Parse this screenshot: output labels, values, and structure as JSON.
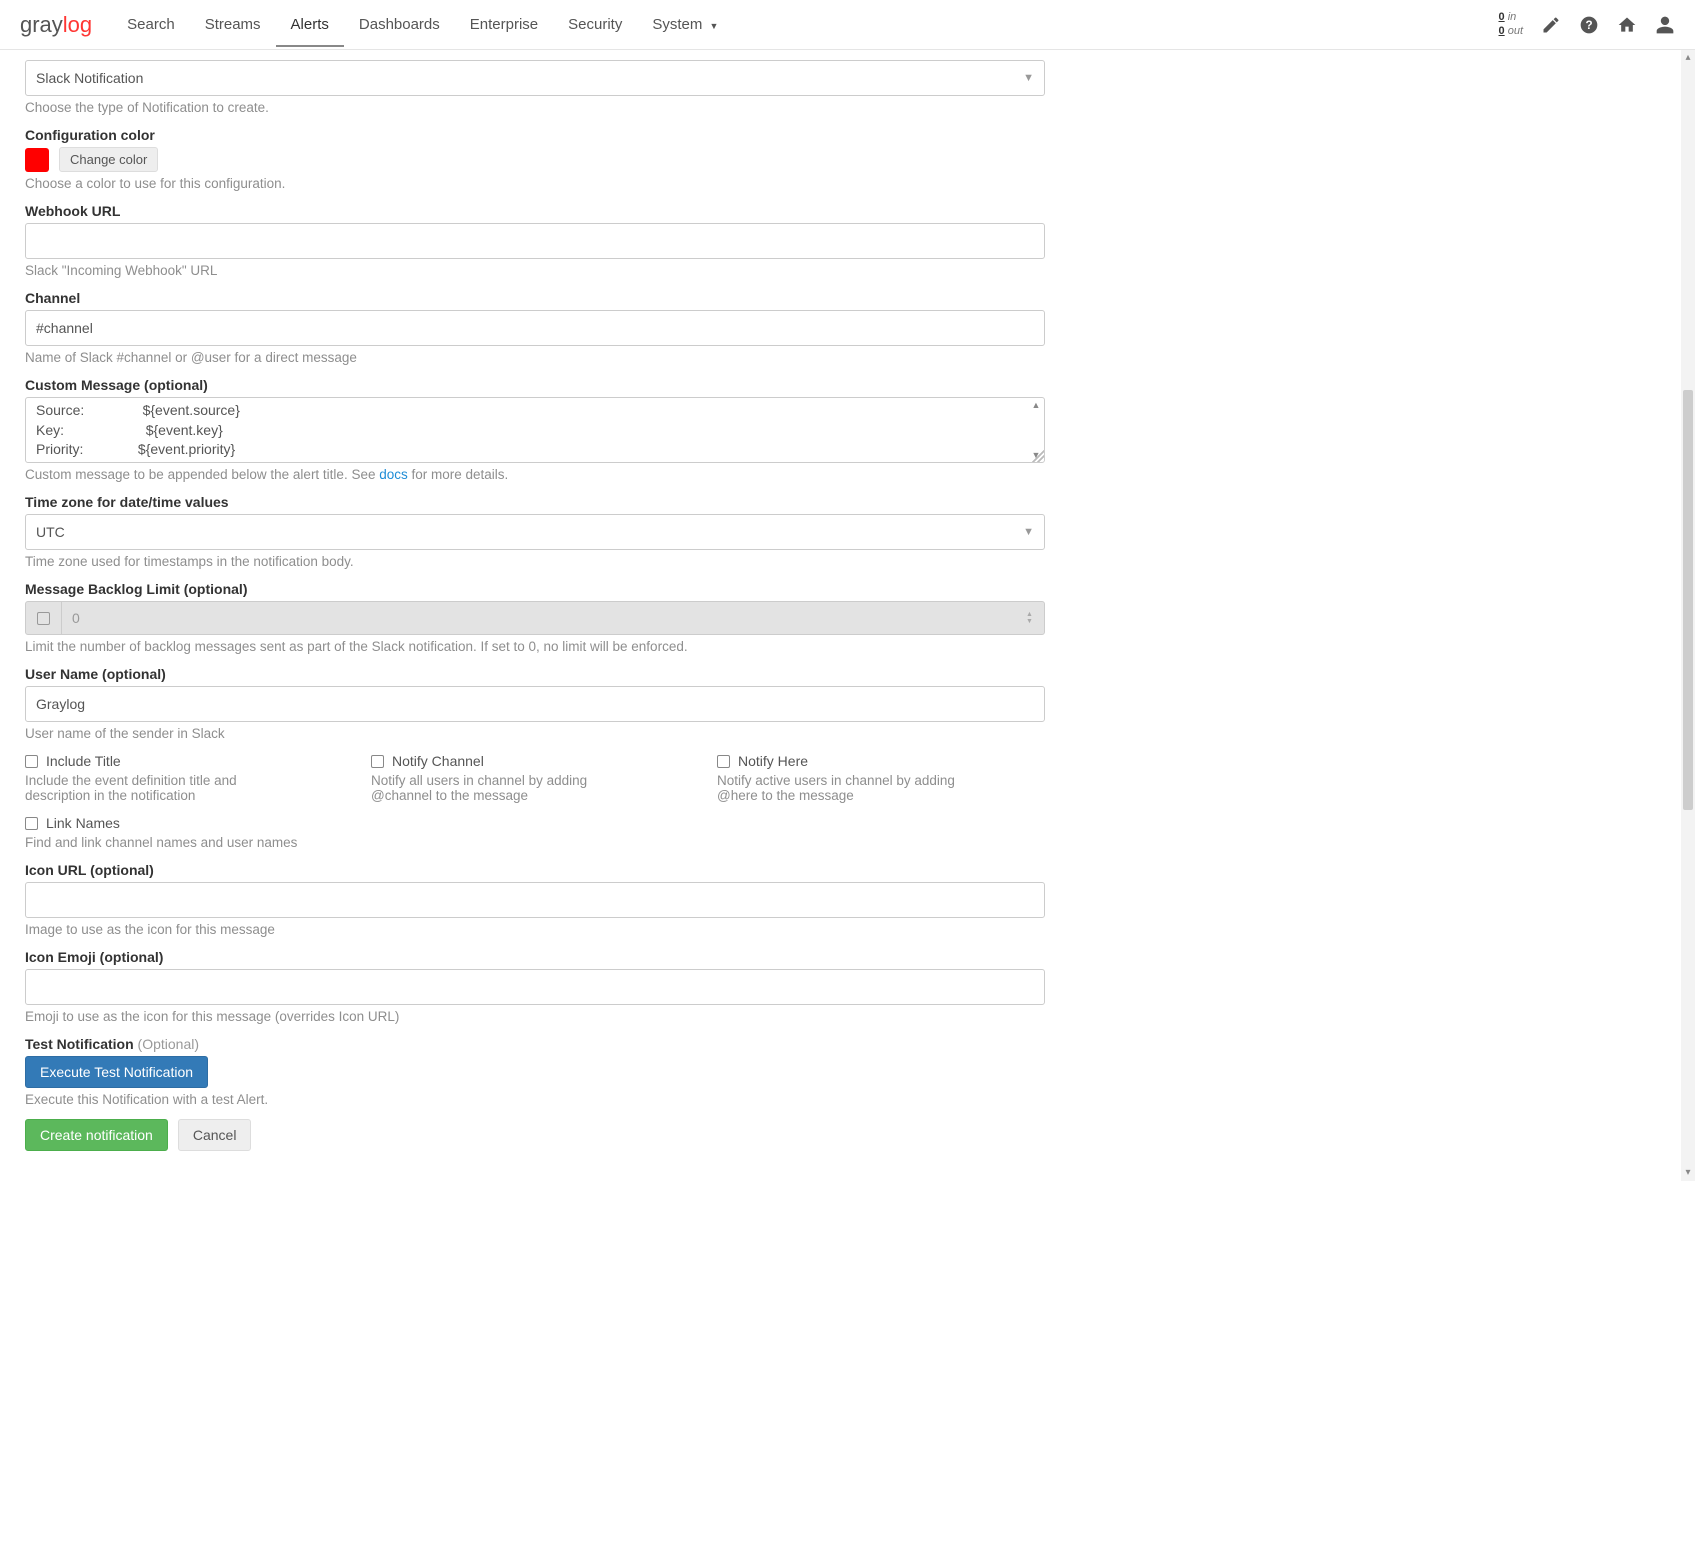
{
  "logo": {
    "part1": "gray",
    "part2": "log"
  },
  "nav": {
    "items": [
      "Search",
      "Streams",
      "Alerts",
      "Dashboards",
      "Enterprise",
      "Security",
      "System"
    ],
    "active": "Alerts",
    "throughput": {
      "in_num": "0",
      "in_lbl": "in",
      "out_num": "0",
      "out_lbl": "out"
    }
  },
  "notif_type": {
    "value": "Slack Notification",
    "help": "Choose the type of Notification to create."
  },
  "config_color": {
    "label": "Configuration color",
    "btn": "Change color",
    "help": "Choose a color to use for this configuration.",
    "value": "#ff0000"
  },
  "webhook": {
    "label": "Webhook URL",
    "value": "",
    "help": "Slack \"Incoming Webhook\" URL"
  },
  "channel": {
    "label": "Channel",
    "value": "#channel",
    "help": "Name of Slack #channel or @user for a direct message"
  },
  "custom_msg": {
    "label": "Custom Message (optional)",
    "value": "Source:               ${event.source}\nKey:                     ${event.key}\nPriority:              ${event.priority}\nAlert:                   ${event.alert}",
    "help_pre": "Custom message to be appended below the alert title. See ",
    "help_link": "docs",
    "help_post": " for more details."
  },
  "timezone": {
    "label": "Time zone for date/time values",
    "value": "UTC",
    "help": "Time zone used for timestamps in the notification body."
  },
  "backlog": {
    "label": "Message Backlog Limit (optional)",
    "placeholder": "0",
    "help": "Limit the number of backlog messages sent as part of the Slack notification. If set to 0, no limit will be enforced."
  },
  "username": {
    "label": "User Name (optional)",
    "value": "Graylog",
    "help": "User name of the sender in Slack"
  },
  "checks": {
    "include_title": {
      "label": "Include Title",
      "help": "Include the event definition title and description in the notification"
    },
    "notify_channel": {
      "label": "Notify Channel",
      "help": "Notify all users in channel by adding @channel to the message"
    },
    "notify_here": {
      "label": "Notify Here",
      "help": "Notify active users in channel by adding @here to the message"
    },
    "link_names": {
      "label": "Link Names",
      "help": "Find and link channel names and user names"
    }
  },
  "icon_url": {
    "label": "Icon URL (optional)",
    "value": "",
    "help": "Image to use as the icon for this message"
  },
  "icon_emoji": {
    "label": "Icon Emoji (optional)",
    "value": "",
    "help": "Emoji to use as the icon for this message (overrides Icon URL)"
  },
  "test": {
    "label": "Test Notification ",
    "opt": "(Optional)",
    "btn": "Execute Test Notification",
    "help": "Execute this Notification with a test Alert."
  },
  "actions": {
    "create": "Create notification",
    "cancel": "Cancel"
  }
}
